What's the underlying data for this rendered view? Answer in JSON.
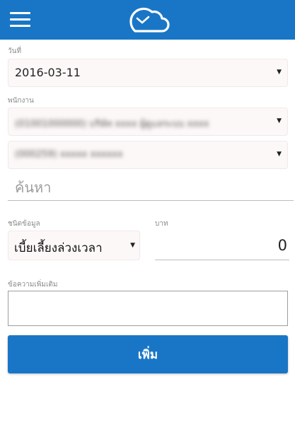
{
  "header": {
    "menu_icon": "hamburger-menu-icon",
    "logo_icon": "cloud-clock-logo-icon",
    "bar_color": "#1976c6"
  },
  "form": {
    "date": {
      "label": "วันที่",
      "value": "2016-03-11"
    },
    "employee": {
      "label": "พนักงาน",
      "company_value": "(01001000000) บริษัท xxxx ผู้ดูแลระบบ xxxx",
      "person_value": "(000259) xxxxx xxxxxx"
    },
    "search": {
      "placeholder": "ค้นหา"
    },
    "type": {
      "label": "ชนิดข้อมูล",
      "value": "เบี้ยเลี้ยงล่วงเวลา"
    },
    "amount": {
      "label": "บาท",
      "value": "0"
    },
    "note": {
      "label": "ข้อความเพิ่มเติม",
      "value": ""
    },
    "submit_label": "เพิ่ม"
  }
}
